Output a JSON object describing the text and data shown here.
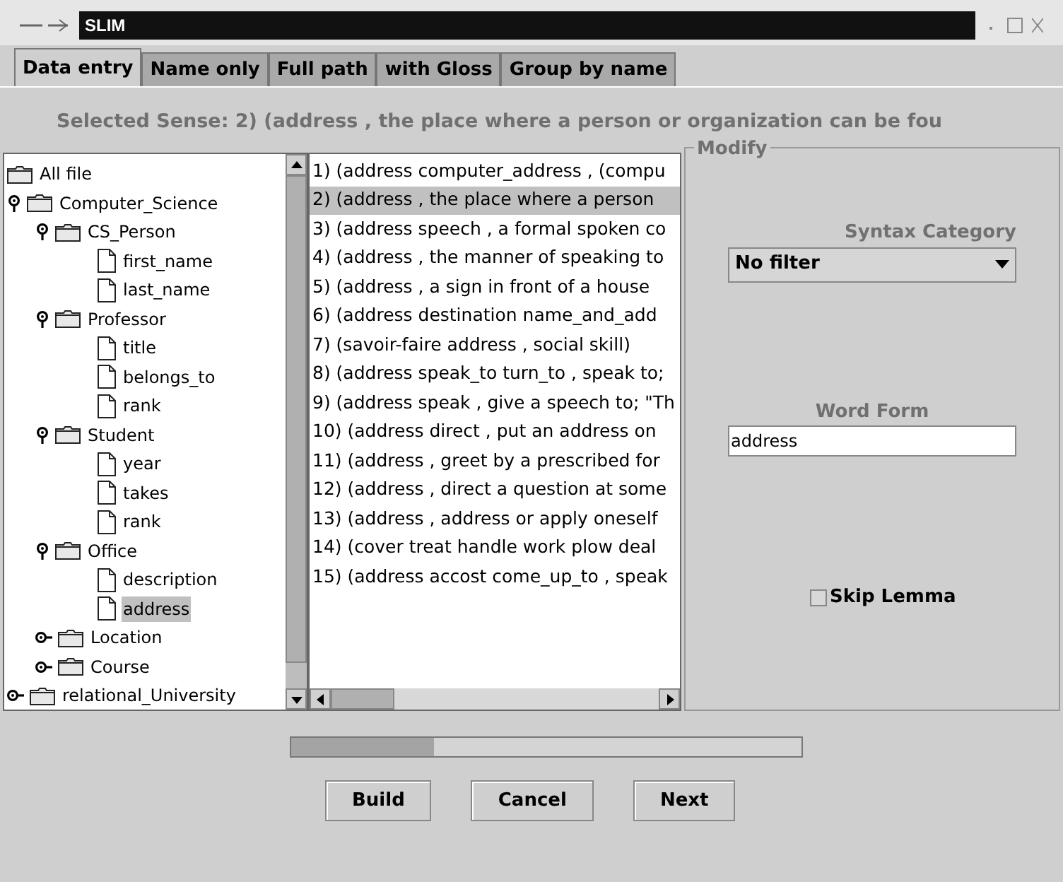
{
  "window": {
    "title": "SLIM"
  },
  "tabs": [
    {
      "label": "Data entry",
      "selected": true
    },
    {
      "label": "Name only",
      "selected": false
    },
    {
      "label": "Full path",
      "selected": false
    },
    {
      "label": "with Gloss",
      "selected": false
    },
    {
      "label": "Group by name",
      "selected": false
    }
  ],
  "selected_sense": "Selected Sense: 2) (address , the place where a person or organization can be fou",
  "tree": [
    {
      "label": "All file",
      "kind": "folder",
      "selected": false
    },
    {
      "label": "Computer_Science",
      "kind": "folder",
      "expanded": true,
      "selected": false,
      "children": [
        {
          "label": "CS_Person",
          "kind": "folder",
          "expanded": true,
          "selected": false,
          "children": [
            {
              "label": "first_name",
              "kind": "leaf",
              "selected": false
            },
            {
              "label": "last_name",
              "kind": "leaf",
              "selected": false
            }
          ]
        },
        {
          "label": "Professor",
          "kind": "folder",
          "expanded": true,
          "selected": false,
          "children": [
            {
              "label": "title",
              "kind": "leaf",
              "selected": false
            },
            {
              "label": "belongs_to",
              "kind": "leaf",
              "selected": false
            },
            {
              "label": "rank",
              "kind": "leaf",
              "selected": false
            }
          ]
        },
        {
          "label": "Student",
          "kind": "folder",
          "expanded": true,
          "selected": false,
          "children": [
            {
              "label": "year",
              "kind": "leaf",
              "selected": false
            },
            {
              "label": "takes",
              "kind": "leaf",
              "selected": false
            },
            {
              "label": "rank",
              "kind": "leaf",
              "selected": false
            }
          ]
        },
        {
          "label": "Office",
          "kind": "folder",
          "expanded": true,
          "selected": false,
          "children": [
            {
              "label": "description",
              "kind": "leaf",
              "selected": false
            },
            {
              "label": "address",
              "kind": "leaf",
              "selected": true
            }
          ]
        },
        {
          "label": "Location",
          "kind": "folder",
          "expanded": false,
          "selected": false
        },
        {
          "label": "Course",
          "kind": "folder",
          "expanded": false,
          "selected": false
        }
      ]
    },
    {
      "label": "relational_University",
      "kind": "folder",
      "expanded": false,
      "selected": false
    }
  ],
  "senses": [
    {
      "text": "1) (address computer_address , (compu",
      "selected": false
    },
    {
      "text": "2) (address , the place where a person",
      "selected": true
    },
    {
      "text": "3) (address speech , a formal spoken co",
      "selected": false
    },
    {
      "text": "4) (address , the manner of speaking to",
      "selected": false
    },
    {
      "text": "5) (address , a sign in front of a house",
      "selected": false
    },
    {
      "text": "6) (address destination name_and_add",
      "selected": false
    },
    {
      "text": "7) (savoir-faire address , social skill)",
      "selected": false
    },
    {
      "text": "8) (address speak_to turn_to , speak to;",
      "selected": false
    },
    {
      "text": "9) (address speak , give a speech to; \"Th",
      "selected": false
    },
    {
      "text": "10) (address direct , put an address on",
      "selected": false
    },
    {
      "text": "11) (address , greet by a prescribed for",
      "selected": false
    },
    {
      "text": "12) (address , direct a question at some",
      "selected": false
    },
    {
      "text": "13) (address , address or apply oneself",
      "selected": false
    },
    {
      "text": "14) (cover treat handle work plow deal",
      "selected": false
    },
    {
      "text": "15) (address accost come_up_to , speak",
      "selected": false
    }
  ],
  "modify": {
    "title": "Modify",
    "syntax_label": "Syntax Category",
    "syntax_value": "No filter",
    "word_form_label": "Word Form",
    "word_form_value": "address",
    "skip_lemma": {
      "label": "Skip Lemma",
      "checked": false
    }
  },
  "progress": {
    "level": 0.28
  },
  "buttons": [
    "Build",
    "Cancel",
    "Next"
  ]
}
